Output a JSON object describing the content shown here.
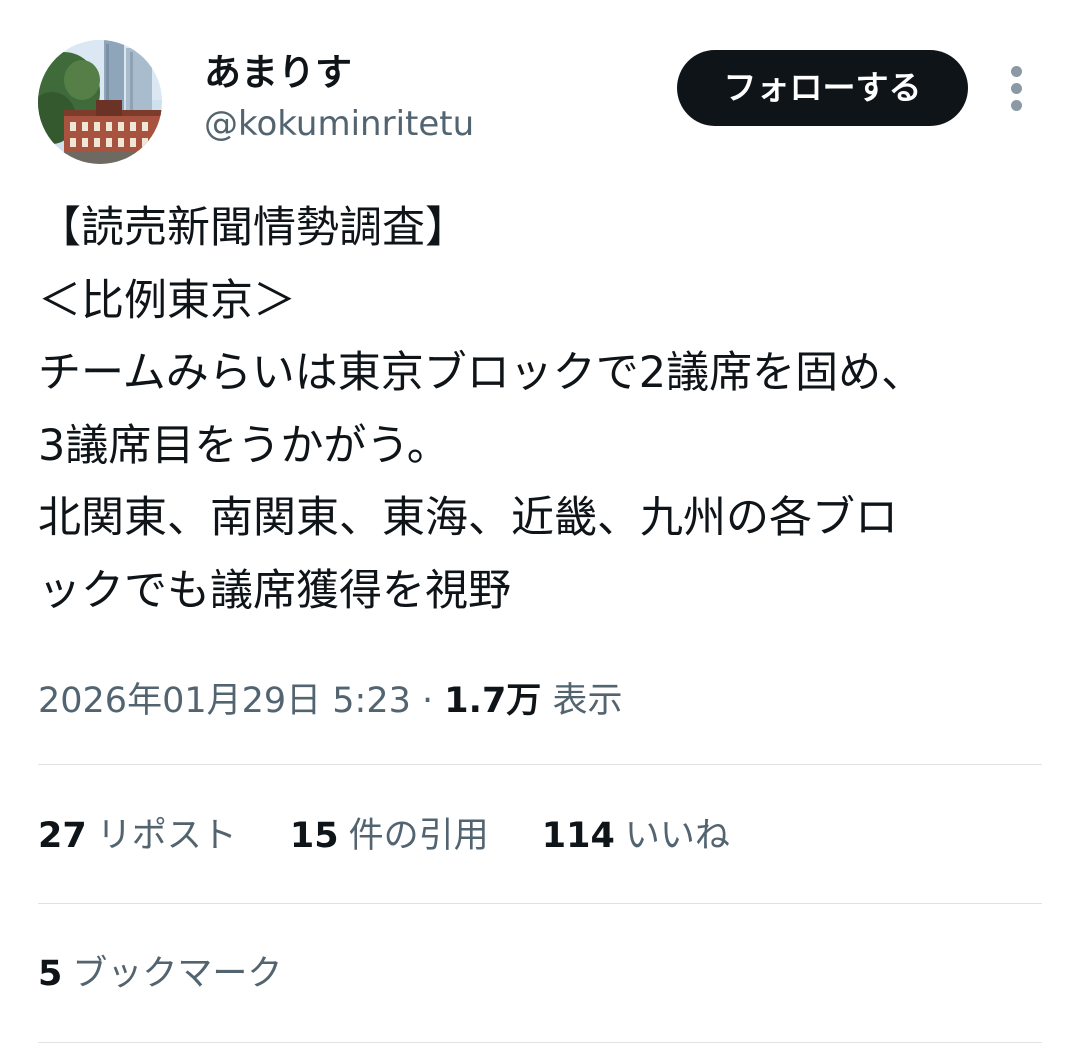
{
  "author": {
    "display_name": "あまりす",
    "handle": "@kokuminritetu",
    "avatar_icon": "station-building-photo"
  },
  "actions": {
    "follow_label": "フォローする",
    "more_icon": "vertical-ellipsis-icon"
  },
  "tweet": {
    "lines": [
      "【読売新聞情勢調査】",
      "＜比例東京＞",
      "チームみらいは東京ブロックで2議席を固め、",
      "3議席目をうかがう。",
      "北関東、南関東、東海、近畿、九州の各ブロ",
      "ックでも議席獲得を視野"
    ]
  },
  "meta": {
    "timestamp": "2026年01月29日 5:23",
    "separator": "·",
    "views_count": "1.7万",
    "views_label": "表示"
  },
  "stats": {
    "reposts_count": "27",
    "reposts_label": "リポスト",
    "quotes_count": "15",
    "quotes_label": "件の引用",
    "likes_count": "114",
    "likes_label": "いいね",
    "bookmarks_count": "5",
    "bookmarks_label": "ブックマーク"
  },
  "colors": {
    "primary_text": "#0f1419",
    "secondary_text": "#536471",
    "follow_button_bg": "#0f1419",
    "divider": "#dfe3e6"
  }
}
